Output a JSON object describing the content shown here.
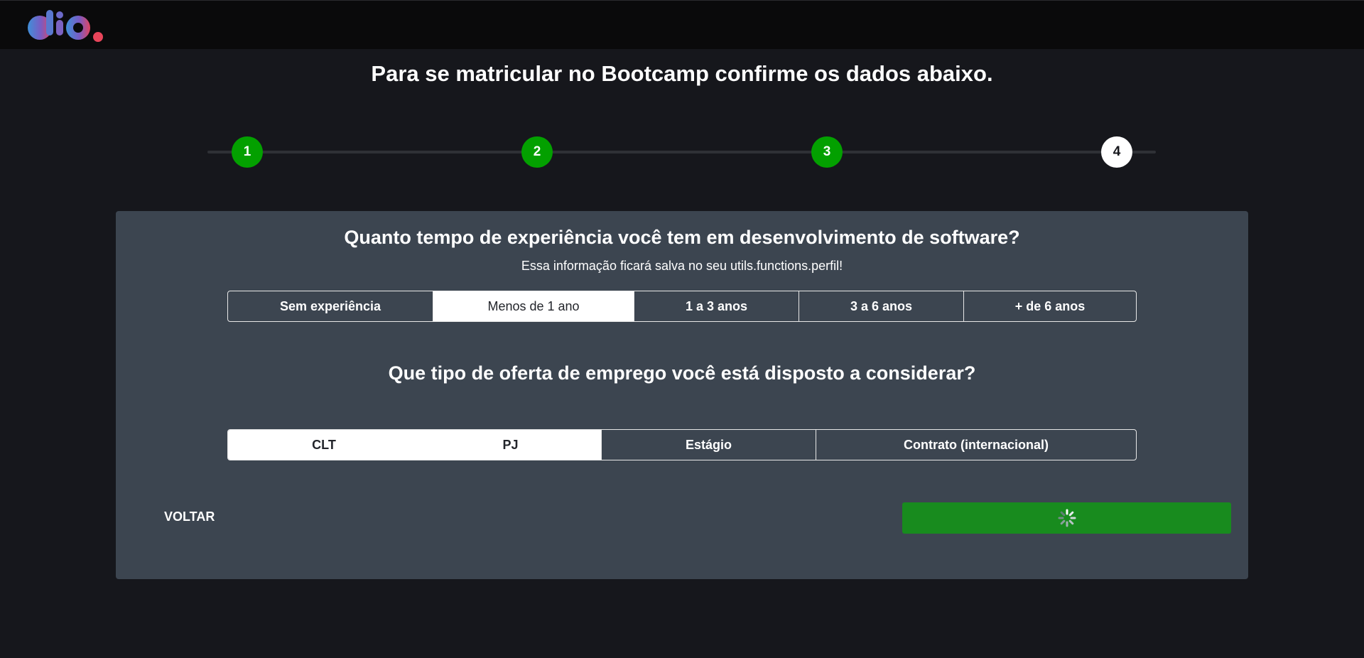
{
  "header": {
    "logo_text": "dio.",
    "logo_icon": "dio-logo"
  },
  "title": "Para se matricular no Bootcamp confirme os dados abaixo.",
  "stepper": {
    "steps": [
      "1",
      "2",
      "3",
      "4"
    ],
    "current_step": 4,
    "done_color": "#03a000"
  },
  "experience": {
    "question": "Quanto tempo de experiência você tem em desenvolvimento de software?",
    "subtitle": "Essa informação ficará salva no seu utils.functions.perfil!",
    "options": [
      "Sem experiência",
      "Menos de 1 ano",
      "1 a 3 anos",
      "3 a 6 anos",
      "+ de 6 anos"
    ],
    "selected": "Menos de 1 ano"
  },
  "offer": {
    "question": "Que tipo de oferta de emprego você está disposto a considerar?",
    "options": [
      "CLT",
      "PJ",
      "Estágio",
      "Contrato (internacional)"
    ],
    "selected": [
      "CLT",
      "PJ"
    ]
  },
  "actions": {
    "back_label": "VOLTAR",
    "next_state": "loading",
    "next_icon": "loading-spinner-icon",
    "next_color": "#188b1e"
  }
}
